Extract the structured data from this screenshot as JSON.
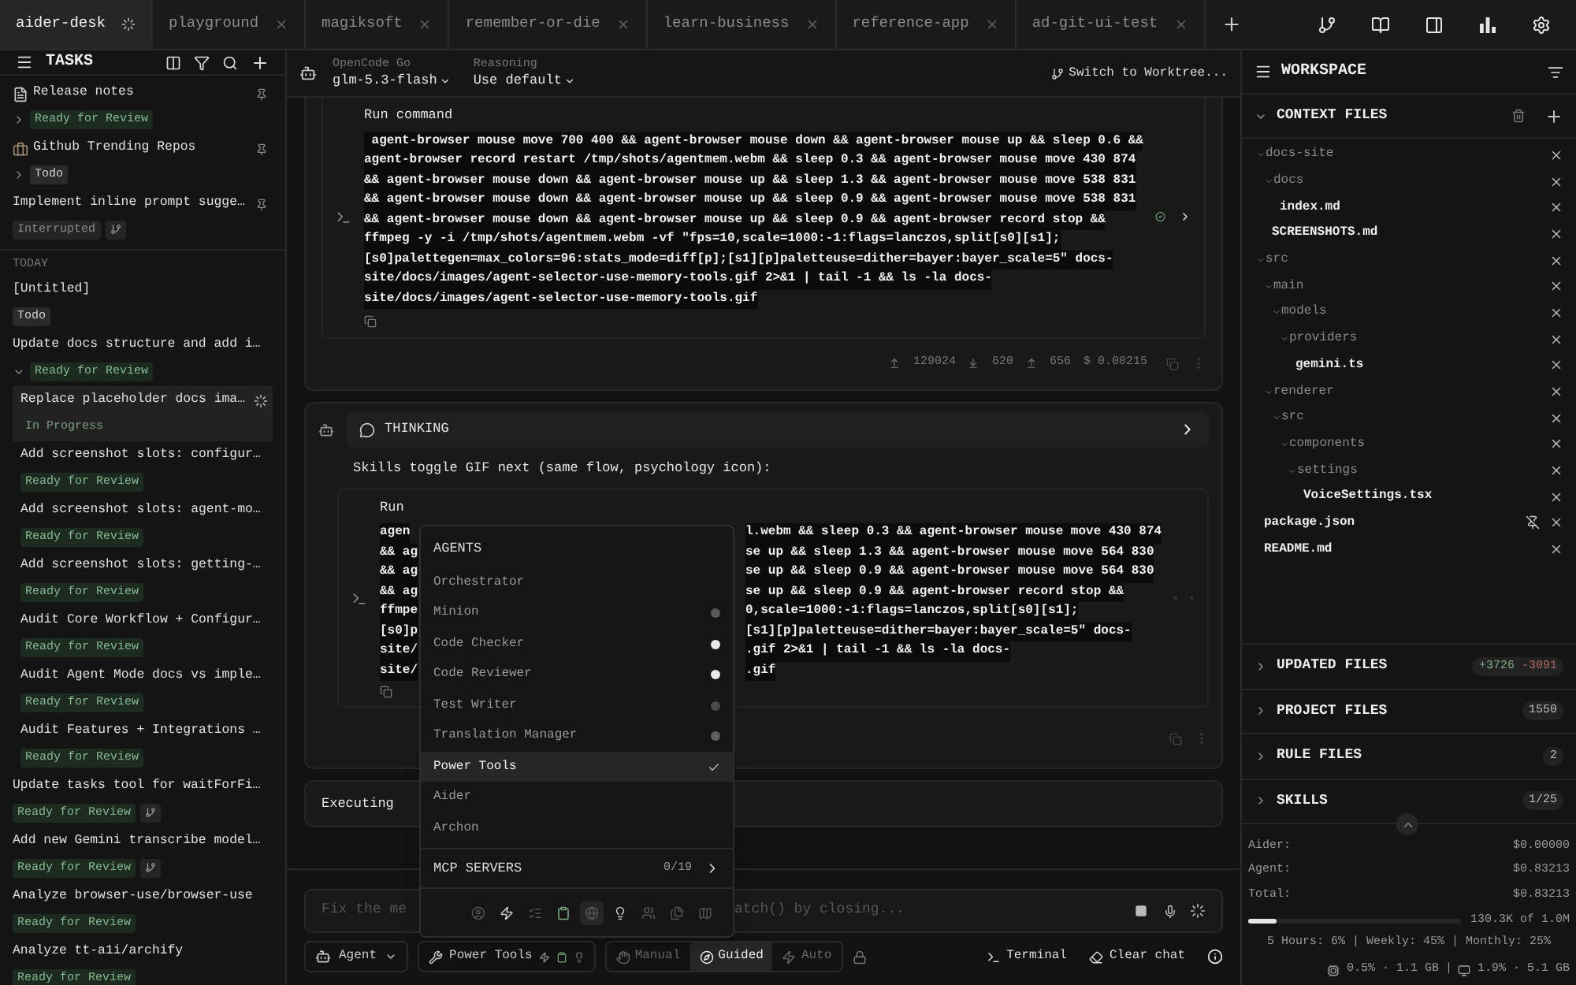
{
  "tabs": [
    {
      "label": "aider-desk",
      "selected": true,
      "busy": true
    },
    {
      "label": "playground",
      "selected": false,
      "busy": false
    },
    {
      "label": "magiksoft",
      "selected": false,
      "busy": false
    },
    {
      "label": "remember-or-die",
      "selected": false,
      "busy": false
    },
    {
      "label": "learn-business",
      "selected": false,
      "busy": false
    },
    {
      "label": "reference-app",
      "selected": false,
      "busy": false
    },
    {
      "label": "ad-git-ui-test",
      "selected": false,
      "busy": false
    }
  ],
  "sidebar": {
    "title": "TASKS",
    "pinned": [
      {
        "title": "Release notes",
        "kind": "note",
        "pinned": true,
        "status": {
          "label": "Ready for Review",
          "kind": "review"
        },
        "expanded": false,
        "selected": false
      },
      {
        "title": "Github Trending Repos",
        "kind": "briefcase",
        "pinned": true,
        "status": {
          "label": "Todo",
          "kind": "todo"
        },
        "expanded": false,
        "selected": false
      },
      {
        "title": "Implement inline prompt sugge…",
        "pinned": true,
        "status": {
          "label": "Interrupted",
          "kind": "interrupted"
        },
        "branch": true,
        "selected": false
      }
    ],
    "section": "TODAY",
    "today": [
      {
        "title": "[Untitled]",
        "status": {
          "label": "Todo",
          "kind": "todo"
        },
        "selected": false
      },
      {
        "title": "Update docs structure and add i…",
        "status": {
          "label": "Ready for Review",
          "kind": "review"
        },
        "expanded": true,
        "selected": false,
        "children": [
          {
            "title": "Replace placeholder docs ima…",
            "status": {
              "label": "In Progress",
              "kind": "progress"
            },
            "busy": true,
            "selected": true
          },
          {
            "title": "Add screenshot slots: configur…",
            "status": {
              "label": "Ready for Review",
              "kind": "review"
            },
            "selected": false
          },
          {
            "title": "Add screenshot slots: agent-mo…",
            "status": {
              "label": "Ready for Review",
              "kind": "review"
            },
            "selected": false
          },
          {
            "title": "Add screenshot slots: getting-…",
            "status": {
              "label": "Ready for Review",
              "kind": "review"
            },
            "selected": false
          },
          {
            "title": "Audit Core Workflow + Configur…",
            "status": {
              "label": "Ready for Review",
              "kind": "review"
            },
            "selected": false
          },
          {
            "title": "Audit Agent Mode docs vs imple…",
            "status": {
              "label": "Ready for Review",
              "kind": "review"
            },
            "selected": false
          },
          {
            "title": "Audit Features + Integrations …",
            "status": {
              "label": "Ready for Review",
              "kind": "review"
            },
            "selected": false
          }
        ]
      },
      {
        "title": "Update tasks tool for waitForFi…",
        "status": {
          "label": "Ready for Review",
          "kind": "review"
        },
        "branch": true,
        "selected": false
      },
      {
        "title": "Add new Gemini transcribe model…",
        "status": {
          "label": "Ready for Review",
          "kind": "review"
        },
        "branch": true,
        "selected": false
      },
      {
        "title": "Analyze browser-use/browser-use",
        "status": {
          "label": "Ready for Review",
          "kind": "review"
        },
        "selected": false
      },
      {
        "title": "Analyze tt-a1i/archify",
        "status": {
          "label": "Ready for Review",
          "kind": "review"
        },
        "selected": false
      }
    ]
  },
  "chat_header": {
    "provider": "OpenCode Go",
    "model": "glm-5.3-flash",
    "reasoning_label": "Reasoning",
    "reasoning": "Use default",
    "worktree_button": "Switch to Worktree..."
  },
  "messages": [
    {
      "kind": "command",
      "title": "Run command",
      "complete": true,
      "lines": [
        " agent-browser mouse move 700 400 && agent-browser mouse down && agent-browser mouse up && sleep 0.6 &&",
        "agent-browser record restart /tmp/shots/agentmem.webm && sleep 0.3 && agent-browser mouse move 430 874",
        "&& agent-browser mouse down && agent-browser mouse up && sleep 1.3 && agent-browser mouse move 538 831",
        "&& agent-browser mouse down && agent-browser mouse up && sleep 0.9 && agent-browser mouse move 538 831",
        "&& agent-browser mouse down && agent-browser mouse up && sleep 0.9 && agent-browser record stop &&",
        "ffmpeg -y -i /tmp/shots/agentmem.webm -vf \"fps=10,scale=1000:-1:flags=lanczos,split[s0][s1];",
        "[s0]palettegen=max_colors=96:stats_mode=diff[p];[s1][p]paletteuse=dither=bayer:bayer_scale=5\" docs-",
        "site/docs/images/agent-selector-use-memory-tools.gif 2>&1 | tail -1 && ls -la docs-",
        "site/docs/images/agent-selector-use-memory-tools.gif"
      ],
      "stats": {
        "sent": "129024",
        "received": "620",
        "cached": "656",
        "cost": "$ 0.00215"
      }
    },
    {
      "kind": "thinking",
      "header": "THINKING",
      "text": "Skills toggle GIF next (same flow, psychology icon):",
      "title": "Run",
      "complete": false,
      "lines_left": [
        "agen",
        "&& ag",
        "&& ag",
        "&& ag",
        "ffmpe",
        "[s0]p",
        "site/",
        "site/"
      ],
      "lines_right": [
        "l.webm && sleep 0.3 && agent-browser mouse move 430 874",
        "se up && sleep 1.3 && agent-browser mouse move 564 830",
        "se up && sleep 0.9 && agent-browser mouse move 564 830",
        "se up && sleep 0.9 && agent-browser record stop &&",
        "0,scale=1000:-1:flags=lanczos,split[s0][s1];",
        "[s1][p]paletteuse=dither=bayer:bayer_scale=5\" docs-",
        ".gif 2>&1 | tail -1 && ls -la docs-",
        ".gif"
      ]
    }
  ],
  "executing": "Executing",
  "input": {
    "placeholder_left": "Fix the me",
    "placeholder_right": "atch() by closing..."
  },
  "toolbar": {
    "agent_button": "Agent",
    "tools_button": "Power Tools",
    "modes": [
      {
        "label": "Manual",
        "kind": "hand",
        "selected": false
      },
      {
        "label": "Guided",
        "kind": "compass",
        "selected": true
      },
      {
        "label": "Auto",
        "kind": "bolt",
        "selected": false
      }
    ],
    "terminal_button": "Terminal",
    "clear_button": "Clear chat"
  },
  "agent_menu": {
    "header": "AGENTS",
    "items": [
      {
        "label": "Orchestrator",
        "selected": false
      },
      {
        "label": "Minion",
        "color": "#5a5a5a",
        "selected": false
      },
      {
        "label": "Code Checker",
        "color": "#e8e8e8",
        "selected": false
      },
      {
        "label": "Code Reviewer",
        "color": "#e8e8e8",
        "selected": false
      },
      {
        "label": "Test Writer",
        "color": "#4a4a4a",
        "selected": false
      },
      {
        "label": "Translation Manager",
        "color": "#5f5f5f",
        "selected": false
      },
      {
        "label": "Power Tools",
        "selected": true
      },
      {
        "label": "Aider",
        "selected": false
      },
      {
        "label": "Archon",
        "selected": false
      }
    ],
    "mcp_label": "MCP SERVERS",
    "mcp_count": "0/19",
    "toggles": [
      {
        "kind": "agent",
        "on": false,
        "selected": false
      },
      {
        "kind": "bolt",
        "on": true,
        "selected": false
      },
      {
        "kind": "checklist",
        "on": false,
        "selected": false
      },
      {
        "kind": "clipboard",
        "on": true,
        "selected": false
      },
      {
        "kind": "globe",
        "on": false,
        "selected": true
      },
      {
        "kind": "bulb",
        "on": true,
        "selected": false
      },
      {
        "kind": "users",
        "on": false,
        "selected": false
      },
      {
        "kind": "files",
        "on": false,
        "selected": false
      },
      {
        "kind": "map",
        "on": false,
        "selected": false
      }
    ]
  },
  "workspace": {
    "title": "WORKSPACE",
    "context_title": "CONTEXT FILES",
    "context_expanded": true,
    "tree": [
      {
        "name": "docs-site",
        "expanded": true,
        "children": [
          {
            "name": "docs",
            "expanded": true,
            "children": [
              {
                "name": "index.md"
              }
            ]
          },
          {
            "name": "SCREENSHOTS.md"
          }
        ]
      },
      {
        "name": "src",
        "expanded": true,
        "children": [
          {
            "name": "main",
            "expanded": true,
            "children": [
              {
                "name": "models",
                "expanded": true,
                "children": [
                  {
                    "name": "providers",
                    "expanded": true,
                    "children": [
                      {
                        "name": "gemini.ts"
                      }
                    ]
                  }
                ]
              }
            ]
          },
          {
            "name": "renderer",
            "expanded": true,
            "children": [
              {
                "name": "src",
                "expanded": true,
                "children": [
                  {
                    "name": "components",
                    "expanded": true,
                    "children": [
                      {
                        "name": "settings",
                        "expanded": true,
                        "children": [
                          {
                            "name": "VoiceSettings.tsx"
                          }
                        ]
                      }
                    ]
                  }
                ]
              }
            ]
          }
        ]
      },
      {
        "name": "package.json",
        "read_only": true
      },
      {
        "name": "README.md"
      }
    ],
    "sections": [
      {
        "title": "UPDATED FILES",
        "expanded": false,
        "added": "+3726",
        "removed": "-3091"
      },
      {
        "title": "PROJECT FILES",
        "expanded": false,
        "count": "1550"
      },
      {
        "title": "RULE FILES",
        "expanded": false,
        "count": "2"
      },
      {
        "title": "SKILLS",
        "expanded": false,
        "count": "1/25"
      }
    ],
    "costs": [
      {
        "label": "Aider:",
        "value": "$0.00000"
      },
      {
        "label": "Agent:",
        "value": "$0.83213"
      },
      {
        "label": "Total:",
        "value": "$0.83213"
      }
    ],
    "tokens": {
      "level": 0.13,
      "reading": "130.3K of 1.0M"
    },
    "usage": "5 Hours: 6% | Weekly: 45% | Monthly: 25%",
    "system": {
      "cpu": "0.5% · 1.1 GB",
      "separator": "|",
      "memory": "1.9% · 5.1 GB"
    }
  }
}
